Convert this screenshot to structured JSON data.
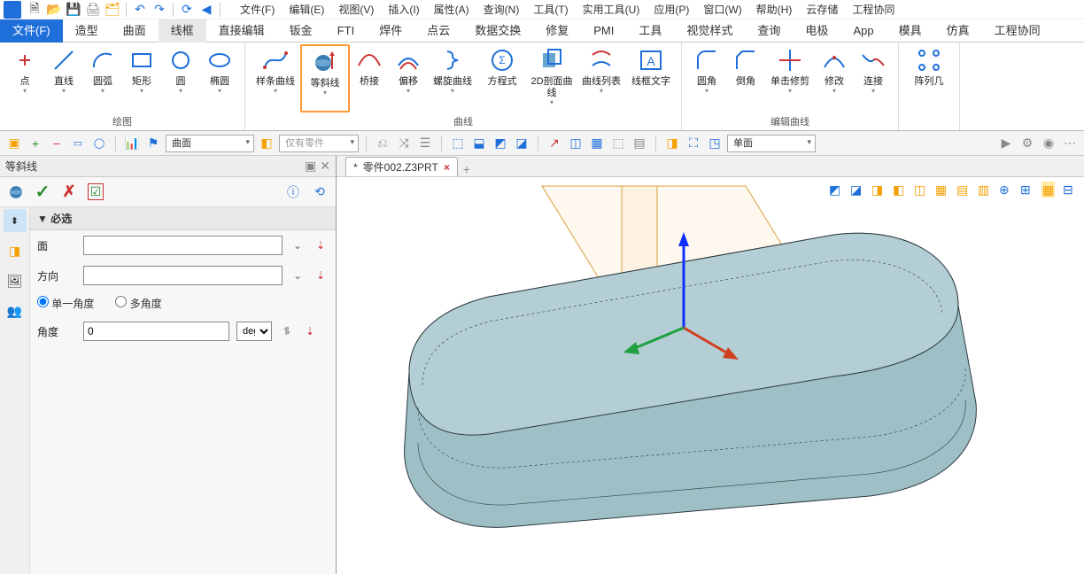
{
  "menu": [
    "文件(F)",
    "编辑(E)",
    "视图(V)",
    "插入(I)",
    "属性(A)",
    "查询(N)",
    "工具(T)",
    "实用工具(U)",
    "应用(P)",
    "窗口(W)",
    "帮助(H)",
    "云存储",
    "工程协同"
  ],
  "ribbon_tabs": [
    "文件(F)",
    "造型",
    "曲面",
    "线框",
    "直接编辑",
    "钣金",
    "FTI",
    "焊件",
    "点云",
    "数据交换",
    "修复",
    "PMI",
    "工具",
    "视觉样式",
    "查询",
    "电极",
    "App",
    "模具",
    "仿真",
    "工程协同"
  ],
  "active_ribbon_tab_index": 0,
  "current_ribbon_tab_index": 3,
  "ribbon_groups": [
    {
      "title": "绘图",
      "buttons": [
        "点",
        "直线",
        "圆弧",
        "矩形",
        "圆",
        "椭圆"
      ]
    },
    {
      "title": "曲线",
      "buttons": [
        "样条曲线",
        "等斜线",
        "桥接",
        "偏移",
        "螺旋曲线",
        "方程式",
        "2D剖面曲线",
        "曲线列表",
        "线框文字"
      ],
      "highlighted_index": 1
    },
    {
      "title": "编辑曲线",
      "buttons": [
        "圆角",
        "倒角",
        "单击修剪",
        "修改",
        "连接"
      ]
    },
    {
      "title": "",
      "buttons": [
        "阵列几"
      ]
    }
  ],
  "filter_toolbar": {
    "combo1": "曲面",
    "combo1_ro": "仅有零件",
    "combo2": "单面"
  },
  "panel": {
    "title": "等斜线",
    "section": "必选",
    "fields": {
      "face_label": "面",
      "face_value": "",
      "dir_label": "方向",
      "dir_value": "",
      "radio1": "单一角度",
      "radio2": "多角度",
      "angle_label": "角度",
      "angle_value": "0",
      "angle_unit": "deg"
    }
  },
  "doc_tab": {
    "dirty": "*",
    "name": "零件002.Z3PRT"
  }
}
